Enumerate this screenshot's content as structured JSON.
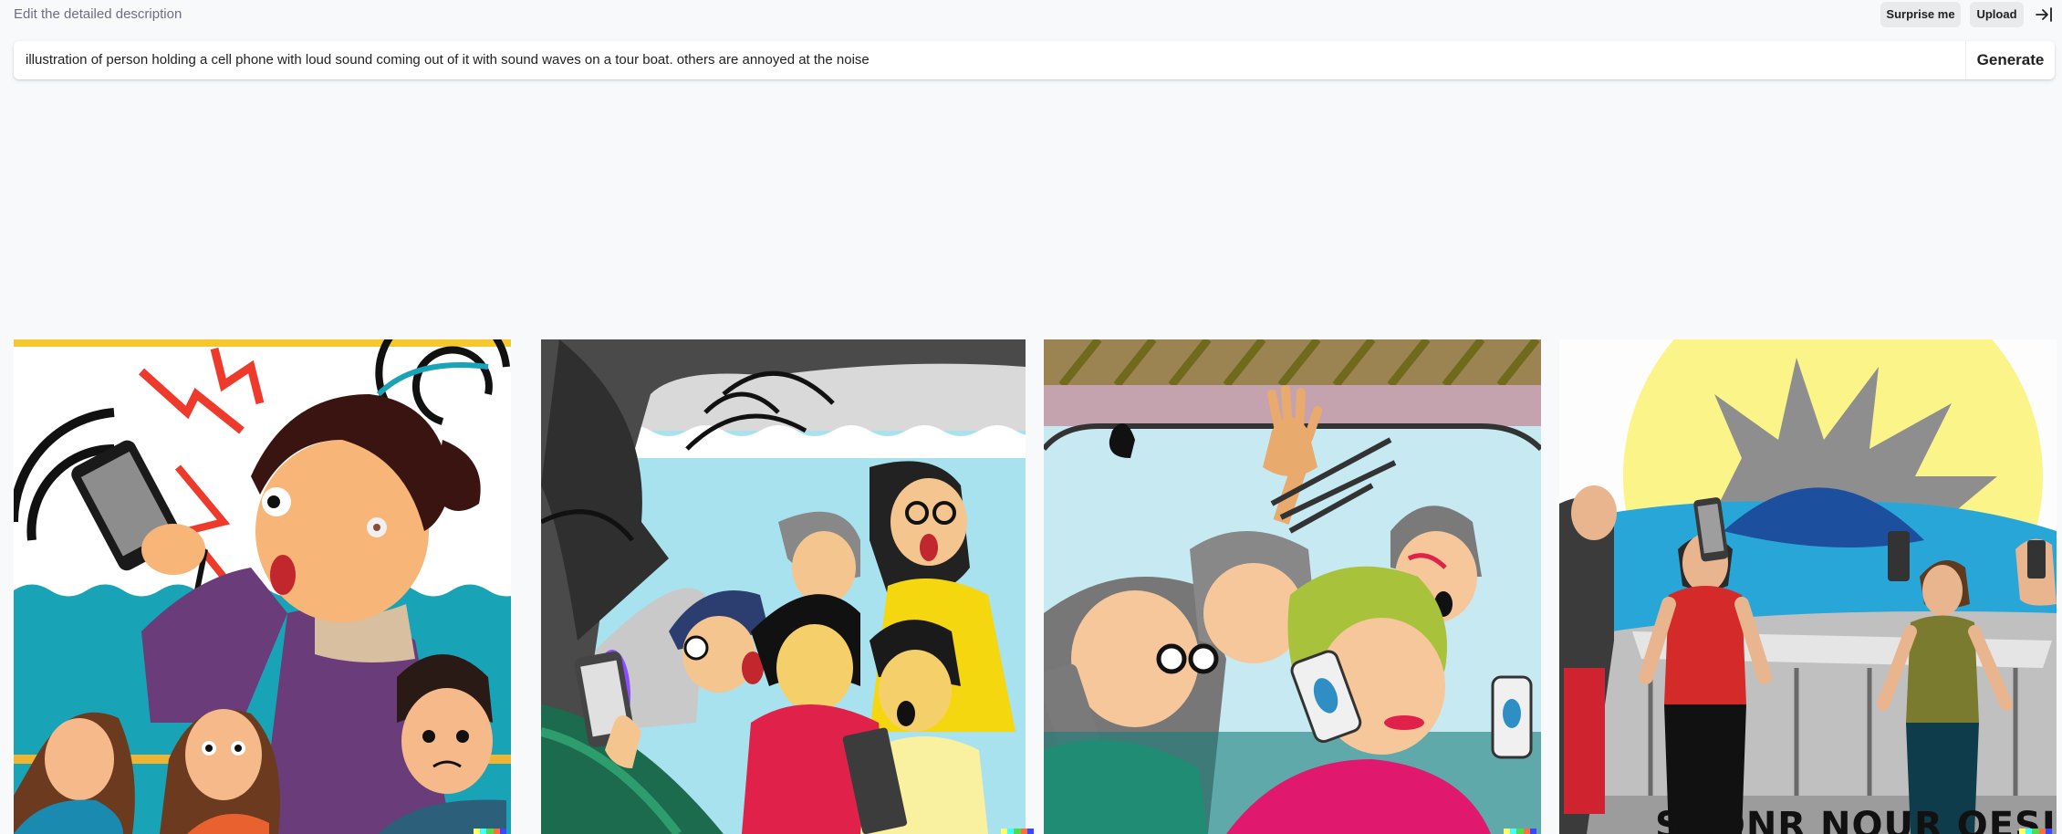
{
  "header": {
    "hint": "Edit the detailed description",
    "surprise_label": "Surprise me",
    "upload_label": "Upload",
    "collapse_icon": "arrow-right-to-line-icon"
  },
  "prompt": {
    "text": "illustration of person holding a cell phone with loud sound coming out of it with sound waves on a tour boat. others are annoyed at the noise",
    "generate_label": "Generate"
  },
  "results": {
    "images": [
      {
        "id": "result-1",
        "poster_text": ""
      },
      {
        "id": "result-2",
        "poster_text": ""
      },
      {
        "id": "result-3",
        "poster_text": ""
      },
      {
        "id": "result-4",
        "poster_text": "SOONR NOUR OESISTY"
      }
    ],
    "watermark_colors": [
      "#ffff66",
      "#42ffff",
      "#51da4c",
      "#ff6e3c",
      "#3c46ff"
    ]
  }
}
